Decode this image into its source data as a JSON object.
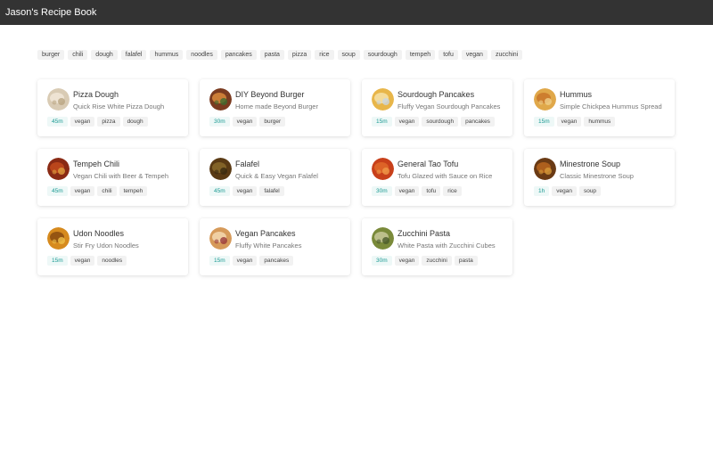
{
  "header": {
    "title": "Jason's Recipe Book"
  },
  "tags": [
    "burger",
    "chili",
    "dough",
    "falafel",
    "hummus",
    "noodles",
    "pancakes",
    "pasta",
    "pizza",
    "rice",
    "soup",
    "sourdough",
    "tempeh",
    "tofu",
    "vegan",
    "zucchini"
  ],
  "recipes": [
    {
      "id": "pizza-dough",
      "title": "Pizza Dough",
      "subtitle": "Quick Rise White Pizza Dough",
      "time": "45m",
      "tags": [
        "vegan",
        "pizza",
        "dough"
      ],
      "thumb": "dough-icon",
      "colors": [
        "#d9cbb4",
        "#f1e8d8",
        "#b9a582"
      ]
    },
    {
      "id": "beyond-burger",
      "title": "DIY Beyond Burger",
      "subtitle": "Home made Beyond Burger",
      "time": "30m",
      "tags": [
        "vegan",
        "burger"
      ],
      "thumb": "burger-icon",
      "colors": [
        "#7a3b20",
        "#d98a3c",
        "#3e6b2f"
      ]
    },
    {
      "id": "sourdough-pancakes",
      "title": "Sourdough Pancakes",
      "subtitle": "Fluffy Vegan Sourdough Pancakes",
      "time": "15m",
      "tags": [
        "vegan",
        "sourdough",
        "pancakes"
      ],
      "thumb": "pancake-icon",
      "colors": [
        "#e8b64a",
        "#f6e2a8",
        "#c9d6e0"
      ]
    },
    {
      "id": "hummus",
      "title": "Hummus",
      "subtitle": "Simple Chickpea Hummus Spread",
      "time": "15m",
      "tags": [
        "vegan",
        "hummus"
      ],
      "thumb": "hummus-icon",
      "colors": [
        "#e0a84a",
        "#c9772a",
        "#f0d08a"
      ]
    },
    {
      "id": "tempeh-chili",
      "title": "Tempeh Chili",
      "subtitle": "Vegan Chili with Beer & Tempeh",
      "time": "45m",
      "tags": [
        "vegan",
        "chili",
        "tempeh"
      ],
      "thumb": "chili-icon",
      "colors": [
        "#8a2a14",
        "#c24a1c",
        "#e0a040"
      ]
    },
    {
      "id": "falafel",
      "title": "Falafel",
      "subtitle": "Quick & Easy Vegan Falafel",
      "time": "45m",
      "tags": [
        "vegan",
        "falafel"
      ],
      "thumb": "falafel-icon",
      "colors": [
        "#5a3a14",
        "#8a6a2a",
        "#3a2a10"
      ]
    },
    {
      "id": "general-tao-tofu",
      "title": "General Tao Tofu",
      "subtitle": "Tofu Glazed with Sauce on Rice",
      "time": "30m",
      "tags": [
        "vegan",
        "tofu",
        "rice"
      ],
      "thumb": "tofu-icon",
      "colors": [
        "#c8401a",
        "#e06a2a",
        "#f09a4a"
      ]
    },
    {
      "id": "minestrone-soup",
      "title": "Minestrone Soup",
      "subtitle": "Classic Minestrone Soup",
      "time": "1h",
      "tags": [
        "vegan",
        "soup"
      ],
      "thumb": "soup-icon",
      "colors": [
        "#6a3a14",
        "#b8661e",
        "#d69a3a"
      ]
    },
    {
      "id": "udon-noodles",
      "title": "Udon Noodles",
      "subtitle": "Stir Fry Udon Noodles",
      "time": "15m",
      "tags": [
        "vegan",
        "noodles"
      ],
      "thumb": "noodles-icon",
      "colors": [
        "#d68a1e",
        "#8a4a10",
        "#f0c04a"
      ]
    },
    {
      "id": "vegan-pancakes",
      "title": "Vegan Pancakes",
      "subtitle": "Fluffy White Pancakes",
      "time": "15m",
      "tags": [
        "vegan",
        "pancakes"
      ],
      "thumb": "pancake-icon",
      "colors": [
        "#d69a5a",
        "#f4d8b0",
        "#9a3a3a"
      ]
    },
    {
      "id": "zucchini-pasta",
      "title": "Zucchini Pasta",
      "subtitle": "White Pasta with Zucchini Cubes",
      "time": "30m",
      "tags": [
        "vegan",
        "zucchini",
        "pasta"
      ],
      "thumb": "pasta-icon",
      "colors": [
        "#7a8a3a",
        "#c8c89a",
        "#4a5a2a"
      ]
    }
  ],
  "theme": {
    "header_bg": "#333333",
    "time_badge_color": "#1a9a93",
    "tag_bg": "#f2f2f2"
  }
}
